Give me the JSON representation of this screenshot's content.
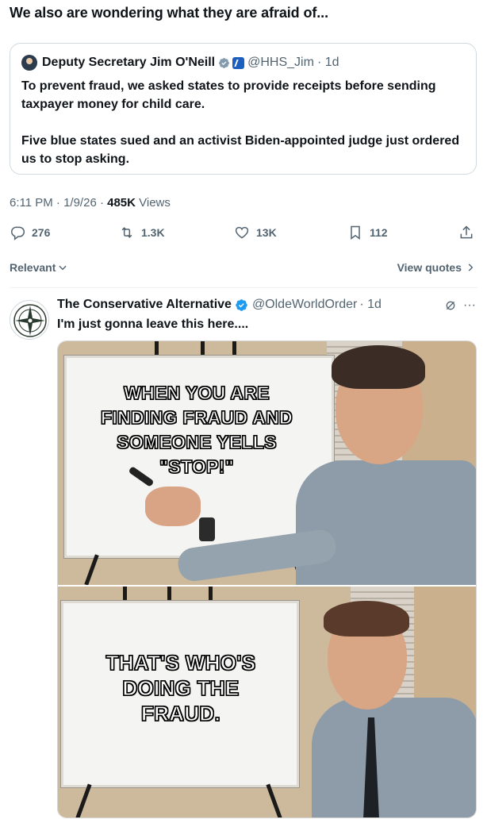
{
  "post": {
    "text": "We also are wondering what they are afraid of..."
  },
  "quoted": {
    "name": "Deputy Secretary Jim O'Neill",
    "handle": "@HHS_Jim",
    "time": "· 1d",
    "paragraph1": "To prevent fraud, we asked states to provide receipts before sending taxpayer money for child care.",
    "paragraph2": "Five blue states sued and an activist Biden-appointed judge just ordered us to stop asking."
  },
  "meta": {
    "time": "6:11 PM · 1/9/26 · ",
    "views_count": "485K",
    "views_label": " Views"
  },
  "actions": {
    "replies": "276",
    "reposts": "1.3K",
    "likes": "13K",
    "bookmarks": "112"
  },
  "sort": {
    "relevant": "Relevant",
    "view_quotes": "View quotes"
  },
  "reply": {
    "name": "The Conservative Alternative",
    "handle": "@OldeWorldOrder",
    "time": "· 1d",
    "more": "···",
    "text": "I'm just gonna leave this here...."
  },
  "meme": {
    "top_caption_lines": [
      "WHEN YOU ARE",
      "FINDING FRAUD AND",
      "SOMEONE YELLS",
      "\"STOP!\""
    ],
    "bottom_caption_lines": [
      "THAT'S WHO'S",
      "DOING THE",
      "FRAUD."
    ]
  },
  "colors": {
    "verified_blue": "#1d9bf0",
    "verified_gray": "#829aab",
    "muted_text": "#536471"
  }
}
